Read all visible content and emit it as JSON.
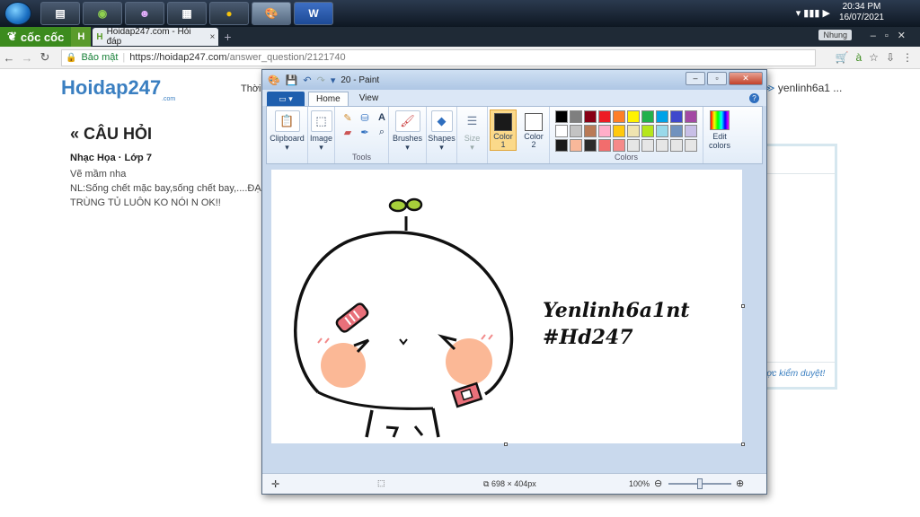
{
  "taskbar": {
    "apps": [
      "file-explorer",
      "coccoc-browser",
      "game",
      "calculator",
      "chrome",
      "paint",
      "word"
    ],
    "word_label": "W",
    "clock_time": "20:34 PM",
    "clock_date": "16/07/2021"
  },
  "browser": {
    "brand": "cốc cốc",
    "tab_title": "Hoidap247.com - Hỏi đáp",
    "tab_close": "×",
    "profile_name": "Nhung",
    "secure_label": "Bảo mật",
    "url_host": "https://hoidap247.com",
    "url_path": "/answer_question/2121740"
  },
  "page": {
    "logo": "Hoidap247",
    "logo_sub": ".com",
    "nav_text": "Thời",
    "user_name": "yenlinh6a1 ...",
    "question_heading": "CÂU HỎI",
    "question_meta": "Nhạc Họa · Lớp 7",
    "question_line1": "Vẽ mầm nha",
    "question_line2": "NL:Sống chết mặc bay,sống chết bay,....ĐẠP TRÙNG TỦ LUÔN KO NÓI N OK!!",
    "review_note": "rợc kiểm duyệt!"
  },
  "paint": {
    "title": "20 - Paint",
    "tabs": [
      "Home",
      "View"
    ],
    "groups": {
      "clipboard": "Clipboard",
      "image": "Image",
      "tools": "Tools",
      "brushes": "Brushes",
      "shapes": "Shapes",
      "size": "Size",
      "color1": "Color 1",
      "color2": "Color 2",
      "colors": "Colors",
      "edit_colors": "Edit colors"
    },
    "color1_value": "#1a1a1a",
    "color2_value": "#ffffff",
    "palette": [
      "#000000",
      "#7f7f7f",
      "#880015",
      "#ed1c24",
      "#ff7f27",
      "#fff200",
      "#22b14c",
      "#00a2e8",
      "#3f48cc",
      "#a349a4",
      "#ffffff",
      "#c3c3c3",
      "#b97a57",
      "#ffaec9",
      "#ffc90e",
      "#efe4b0",
      "#b5e61d",
      "#99d9ea",
      "#7092be",
      "#c8bfe7",
      "#1a1a1a",
      "#f8b89a",
      "#2b2b2b",
      "#f26d6d",
      "#f58a8a",
      "#e6e6e6",
      "#e6e6e6",
      "#e6e6e6",
      "#e6e6e6",
      "#e6e6e6"
    ],
    "drawing_caption_line1": "Yenlinh6a1nt",
    "drawing_caption_line2": "#Hd247",
    "status_dimensions": "698 × 404px",
    "zoom": "100%"
  }
}
